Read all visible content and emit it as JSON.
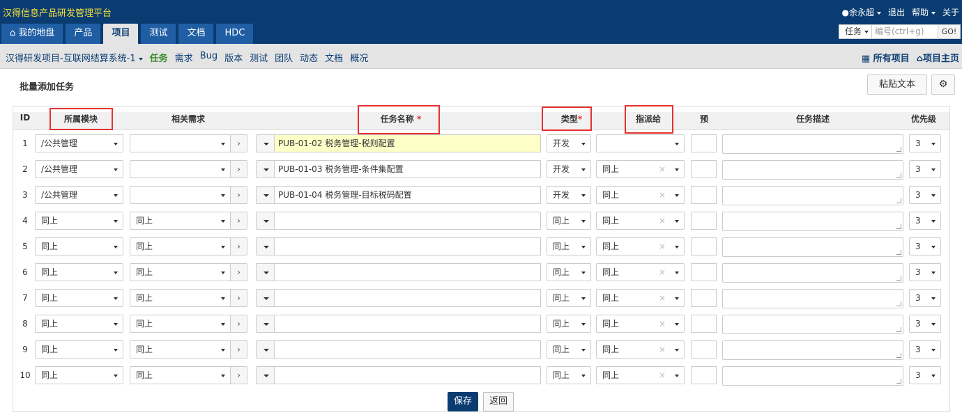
{
  "app": {
    "title": "汉得信息产品研发管理平台"
  },
  "user": {
    "name": "余永超",
    "logout": "退出",
    "help": "帮助",
    "about": "关于"
  },
  "tabs": [
    {
      "label": "我的地盘"
    },
    {
      "label": "产品"
    },
    {
      "label": "项目"
    },
    {
      "label": "测试"
    },
    {
      "label": "文档"
    },
    {
      "label": "HDC"
    }
  ],
  "search": {
    "type": "任务",
    "placeholder": "编号(ctrl+g)",
    "go": "GO!"
  },
  "subnav": {
    "project": "汉得研发项目-互联网结算系统-1",
    "links": [
      "任务",
      "需求",
      "Bug",
      "版本",
      "测试",
      "团队",
      "动态",
      "文档",
      "概况"
    ],
    "all_projects": "所有项目",
    "project_home": "项目主页"
  },
  "page": {
    "title": "批量添加任务",
    "paste_label": "粘贴文本"
  },
  "columns": {
    "id": "ID",
    "module": "所属模块",
    "story": "相关需求",
    "name": "任务名称",
    "type": "类型",
    "assign": "指派给",
    "estimate": "预",
    "desc": "任务描述",
    "priority": "优先级"
  },
  "rows": [
    {
      "id": "1",
      "module": "/公共管理",
      "story": "",
      "name": "PUB-01-02 税务管理-税则配置",
      "type": "开发",
      "assign": "",
      "pri": "3"
    },
    {
      "id": "2",
      "module": "/公共管理",
      "story": "",
      "name": "PUB-01-03 税务管理-条件集配置",
      "type": "开发",
      "assign": "同上",
      "pri": "3"
    },
    {
      "id": "3",
      "module": "/公共管理",
      "story": "",
      "name": "PUB-01-04 税务管理-目标税码配置",
      "type": "开发",
      "assign": "同上",
      "pri": "3"
    },
    {
      "id": "4",
      "module": "同上",
      "story": "同上",
      "name": "",
      "type": "同上",
      "assign": "同上",
      "pri": "3"
    },
    {
      "id": "5",
      "module": "同上",
      "story": "同上",
      "name": "",
      "type": "同上",
      "assign": "同上",
      "pri": "3"
    },
    {
      "id": "6",
      "module": "同上",
      "story": "同上",
      "name": "",
      "type": "同上",
      "assign": "同上",
      "pri": "3"
    },
    {
      "id": "7",
      "module": "同上",
      "story": "同上",
      "name": "",
      "type": "同上",
      "assign": "同上",
      "pri": "3"
    },
    {
      "id": "8",
      "module": "同上",
      "story": "同上",
      "name": "",
      "type": "同上",
      "assign": "同上",
      "pri": "3"
    },
    {
      "id": "9",
      "module": "同上",
      "story": "同上",
      "name": "",
      "type": "同上",
      "assign": "同上",
      "pri": "3"
    },
    {
      "id": "10",
      "module": "同上",
      "story": "同上",
      "name": "",
      "type": "同上",
      "assign": "同上",
      "pri": "3"
    }
  ],
  "buttons": {
    "save": "保存",
    "back": "返回"
  },
  "colors": {
    "header": "#0a3c72",
    "highlight": "#ffffc8",
    "required": "#e53131"
  }
}
